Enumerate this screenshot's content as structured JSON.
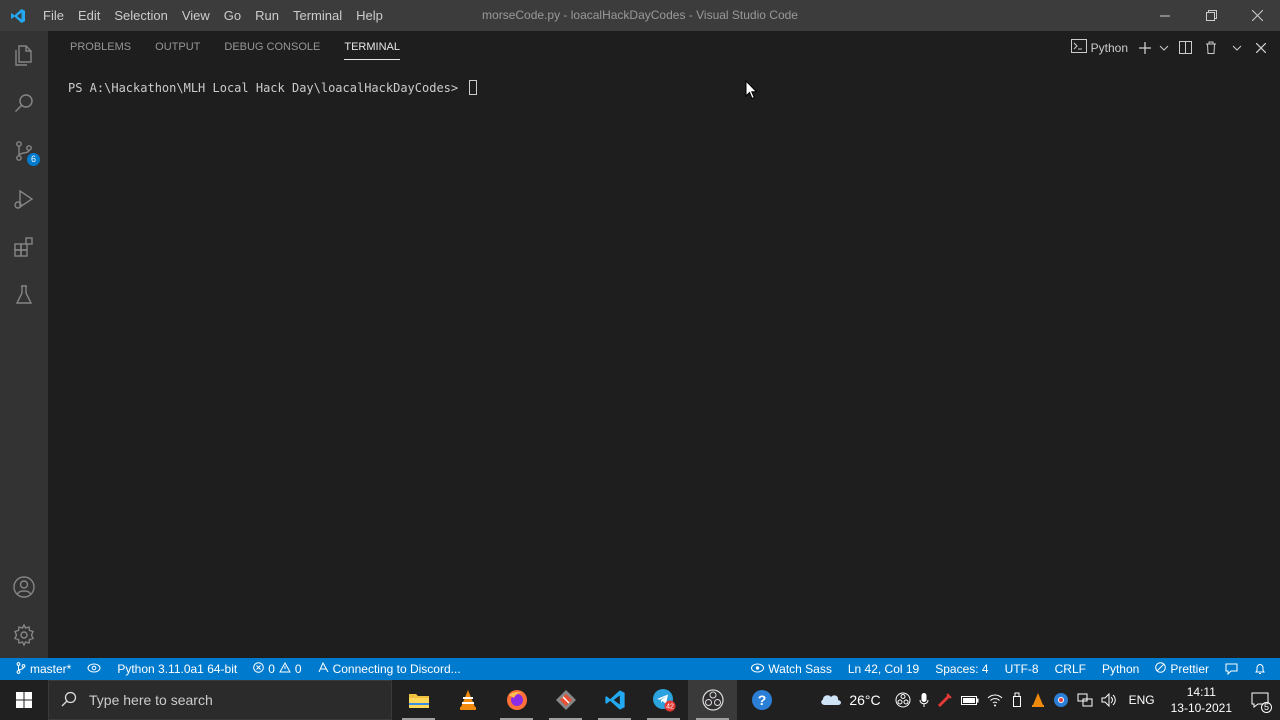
{
  "titlebar": {
    "menu": [
      "File",
      "Edit",
      "Selection",
      "View",
      "Go",
      "Run",
      "Terminal",
      "Help"
    ],
    "window_title": "morseCode.py - loacalHackDayCodes - Visual Studio Code"
  },
  "activitybar": {
    "source_control_badge": "6"
  },
  "panel": {
    "tabs": [
      "PROBLEMS",
      "OUTPUT",
      "DEBUG CONSOLE",
      "TERMINAL"
    ],
    "active_tab": "TERMINAL",
    "terminal_name": "Python",
    "prompt": "PS A:\\Hackathon\\MLH Local Hack Day\\loacalHackDayCodes> "
  },
  "statusbar": {
    "branch": "master*",
    "interpreter": "Python 3.11.0a1 64-bit",
    "errors": "0",
    "warnings": "0",
    "discord": "Connecting to Discord...",
    "watch_sass": "Watch Sass",
    "cursor_position": "Ln 42, Col 19",
    "spaces": "Spaces: 4",
    "encoding": "UTF-8",
    "eol": "CRLF",
    "language": "Python",
    "formatter": "Prettier"
  },
  "taskbar": {
    "search_placeholder": "Type here to search",
    "weather": "26°C",
    "language": "ENG",
    "time": "14:11",
    "date": "13-10-2021",
    "notification_count": "5",
    "telegram_badge": "42"
  },
  "colors": {
    "statusbar": "#007acc",
    "titlebar": "#3c3c3c",
    "activitybar": "#333333",
    "editor_bg": "#1e1e1e",
    "taskbar": "#202020"
  }
}
